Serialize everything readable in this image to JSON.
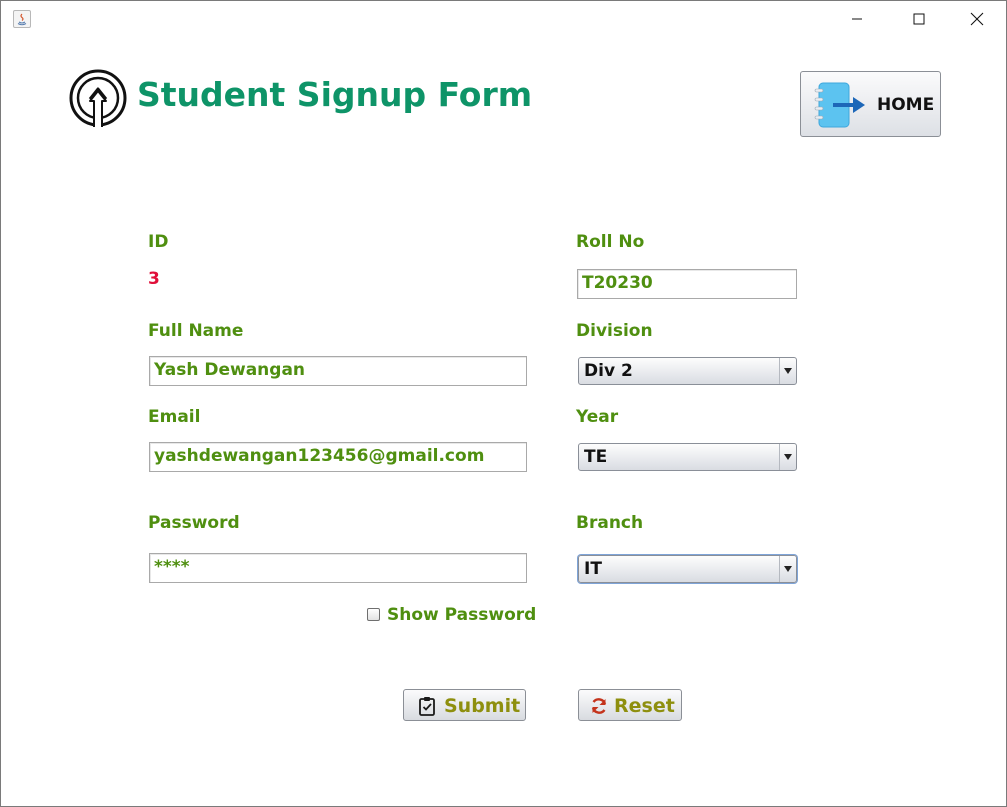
{
  "window": {
    "controls": [
      "minimize",
      "maximize",
      "close"
    ]
  },
  "header": {
    "title": "Student Signup Form",
    "icon": "upload-circle-icon",
    "home_label": "HOME",
    "home_icon": "login-arrow-icon"
  },
  "form": {
    "id_label": "ID",
    "id_value": "3",
    "rollno_label": "Roll No",
    "rollno_value": "T20230",
    "fullname_label": "Full Name",
    "fullname_value": "Yash Dewangan",
    "division_label": "Division",
    "division_value": "Div 2",
    "email_label": "Email",
    "email_value": "yashdewangan123456@gmail.com",
    "year_label": "Year",
    "year_value": "TE",
    "password_label": "Password",
    "password_value": "****",
    "branch_label": "Branch",
    "branch_value": "IT",
    "show_password_label": "Show Password",
    "show_password_checked": false
  },
  "actions": {
    "submit_label": "Submit",
    "reset_label": "Reset"
  },
  "colors": {
    "title": "#0e9468",
    "label": "#4f8f10",
    "id_value": "#e0103a",
    "button_text": "#8e8f0e"
  }
}
